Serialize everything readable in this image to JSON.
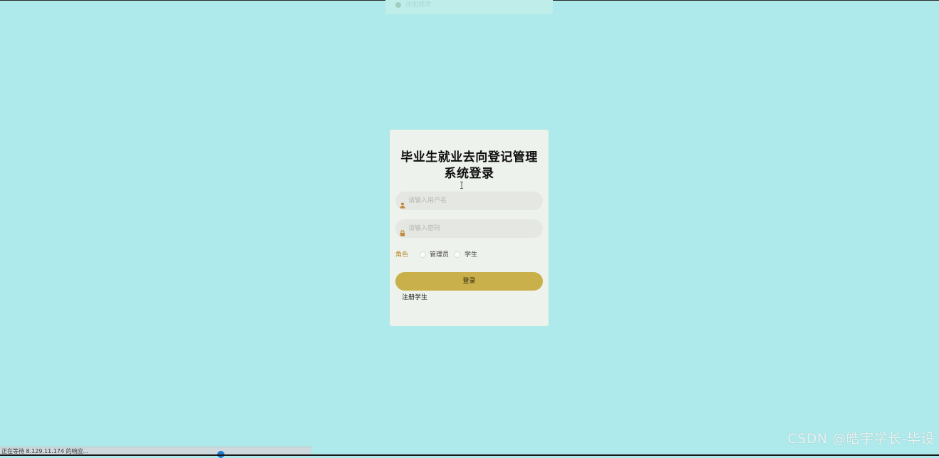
{
  "page": {
    "background_color": "#aeeaeb"
  },
  "toast": {
    "text": "注册成功",
    "icon": "check-circle-icon"
  },
  "login": {
    "title_line1": "毕业生就业去向登记管理",
    "title_line2": "系统登录",
    "username": {
      "placeholder": "请输入用户名",
      "value": "",
      "icon": "user-icon"
    },
    "password": {
      "placeholder": "请输入密码",
      "value": "",
      "icon": "lock-icon"
    },
    "role": {
      "label": "角色",
      "options": [
        "管理员",
        "学生"
      ],
      "selected": ""
    },
    "submit_label": "登录",
    "register_label": "注册学生",
    "colors": {
      "card": "#eef2ec",
      "button": "#c9b04b",
      "role_label": "#b9892e"
    }
  },
  "status_bar": {
    "text": "正在等待 8.129.11.174 的响应...",
    "progress_percent": 71
  },
  "watermark": {
    "text": "CSDN @皓宇学长-毕设"
  }
}
